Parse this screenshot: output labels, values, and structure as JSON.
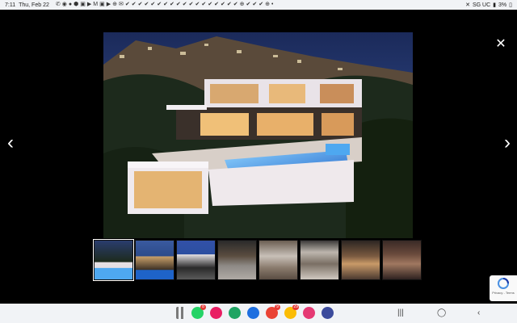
{
  "status_bar": {
    "time": "7:11",
    "date": "Thu, Feb 22",
    "notification_icons": [
      "✆",
      "◉",
      "●",
      "⬢",
      "▣",
      "▶",
      "M",
      "▣",
      "▶",
      "⊕",
      "✉",
      "✔",
      "✔",
      "✔",
      "✔",
      "✔",
      "✔",
      "✔",
      "✔",
      "✔",
      "✔",
      "✔",
      "✔",
      "✔",
      "✔",
      "✔",
      "✔",
      "✔",
      "✔",
      "⊕",
      "✔",
      "✔",
      "✔",
      "⊕",
      "•"
    ],
    "network": "SG UC",
    "battery": "3%"
  },
  "gallery": {
    "close_icon": "✕",
    "prev_icon": "‹",
    "next_icon": "›",
    "thumbnail_count": 8,
    "active_thumbnail": 0
  },
  "recaptcha": {
    "text": "Privacy - Terms"
  },
  "dock": {
    "apps": [
      {
        "name": "grid-apps",
        "color": "#7a7a7a",
        "badge": ""
      },
      {
        "name": "whatsapp",
        "color": "#25d366",
        "badge": "8"
      },
      {
        "name": "phone",
        "color": "#e91e63",
        "badge": ""
      },
      {
        "name": "messenger-c",
        "color": "#1fa463",
        "badge": ""
      },
      {
        "name": "messages",
        "color": "#1e6fe0",
        "badge": ""
      },
      {
        "name": "gmail",
        "color": "#ea4335",
        "badge": "9"
      },
      {
        "name": "chrome",
        "color": "#fbbc05",
        "badge": "29"
      },
      {
        "name": "flower",
        "color": "#e53973",
        "badge": ""
      },
      {
        "name": "settings",
        "color": "#3c4b9c",
        "badge": ""
      }
    ]
  },
  "system_nav": {
    "recents": "|||",
    "home": "◯",
    "back": "‹"
  }
}
